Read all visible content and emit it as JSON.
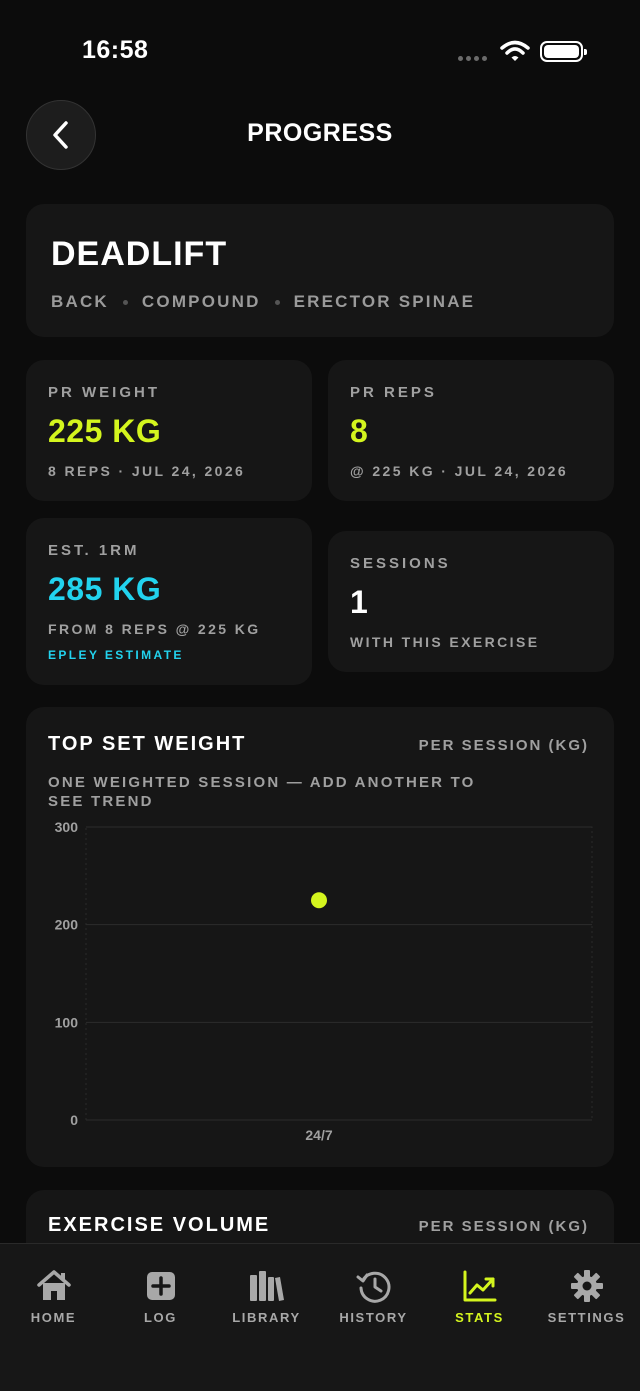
{
  "status_bar": {
    "time": "16:58"
  },
  "header": {
    "title": "PROGRESS"
  },
  "exercise": {
    "name": "DEADLIFT",
    "tags": [
      "BACK",
      "COMPOUND",
      "ERECTOR SPINAE"
    ]
  },
  "stats": {
    "pr_weight": {
      "label": "PR WEIGHT",
      "value": "225 KG",
      "sub": "8 REPS · JUL 24, 2026"
    },
    "pr_reps": {
      "label": "PR REPS",
      "value": "8",
      "sub": "@ 225 KG · JUL 24, 2026"
    },
    "est_1rm": {
      "label": "EST. 1RM",
      "value": "285 KG",
      "sub": "FROM 8 REPS @ 225 KG",
      "method": "EPLEY ESTIMATE"
    },
    "sessions": {
      "label": "SESSIONS",
      "value": "1",
      "sub": "WITH THIS EXERCISE"
    }
  },
  "top_set_chart": {
    "title": "TOP SET WEIGHT",
    "unit_label": "PER SESSION (KG)",
    "note": "ONE WEIGHTED SESSION — ADD ANOTHER TO SEE TREND"
  },
  "volume_chart": {
    "title": "EXERCISE VOLUME",
    "unit_label": "PER SESSION (KG)"
  },
  "tabs": [
    {
      "label": "HOME",
      "icon": "home-icon",
      "active": false
    },
    {
      "label": "LOG",
      "icon": "plus-square-icon",
      "active": false
    },
    {
      "label": "LIBRARY",
      "icon": "library-icon",
      "active": false
    },
    {
      "label": "HISTORY",
      "icon": "history-icon",
      "active": false
    },
    {
      "label": "STATS",
      "icon": "chart-trend-icon",
      "active": true
    },
    {
      "label": "SETTINGS",
      "icon": "gear-icon",
      "active": false
    }
  ],
  "colors": {
    "accent": "#d4f51e",
    "secondary_accent": "#22d3ee",
    "background": "#0c0c0c",
    "card": "#161616"
  },
  "chart_data": {
    "type": "scatter",
    "title": "TOP SET WEIGHT",
    "ylabel": "PER SESSION (KG)",
    "x": [
      "24/7"
    ],
    "y": [
      225
    ],
    "ylim": [
      0,
      300
    ],
    "yticks": [
      0,
      100,
      200,
      300
    ],
    "grid": true
  }
}
